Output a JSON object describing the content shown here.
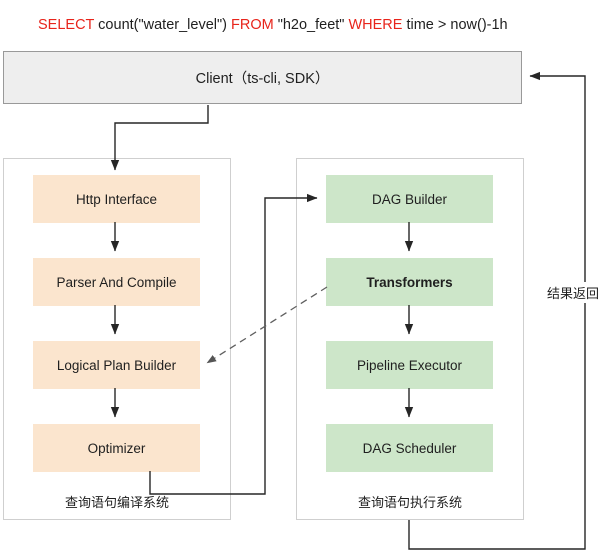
{
  "query": {
    "full_text": "SELECT count(\"water_level\")  FROM \"h2o_feet\" WHERE time > now()-1h",
    "tokens": [
      {
        "text": "SELECT",
        "type": "keyword"
      },
      {
        "text": " count(\"water_level\")  ",
        "type": "plain"
      },
      {
        "text": "FROM",
        "type": "keyword"
      },
      {
        "text": " \"h2o_feet\" ",
        "type": "plain"
      },
      {
        "text": "WHERE",
        "type": "keyword"
      },
      {
        "text": " time > now()-1h",
        "type": "plain"
      }
    ],
    "keyword_color": "#e8241b",
    "text_color": "#1f1f1f"
  },
  "client": {
    "label": "Client（ts-cli, SDK）",
    "fill": "#eeeeee",
    "border": "#999999"
  },
  "panels": {
    "compile": {
      "caption": "查询语句编译系统",
      "node_fill": "#fbe5ce",
      "nodes": [
        {
          "id": "http",
          "label": "Http Interface"
        },
        {
          "id": "parser",
          "label": "Parser And Compile"
        },
        {
          "id": "logical",
          "label": "Logical Plan Builder"
        },
        {
          "id": "optimizer",
          "label": "Optimizer"
        }
      ]
    },
    "execute": {
      "caption": "查询语句执行系统",
      "node_fill": "#cde6c9",
      "nodes": [
        {
          "id": "dagbuilder",
          "label": "DAG Builder"
        },
        {
          "id": "transform",
          "label": "Transformers",
          "bold": true
        },
        {
          "id": "pipeline",
          "label": "Pipeline Executor"
        },
        {
          "id": "dagsched",
          "label": "DAG Scheduler"
        }
      ]
    }
  },
  "edges": {
    "result_return_label": "结果返回",
    "line_color": "#262626",
    "dashed_color": "#6b6b6b"
  }
}
